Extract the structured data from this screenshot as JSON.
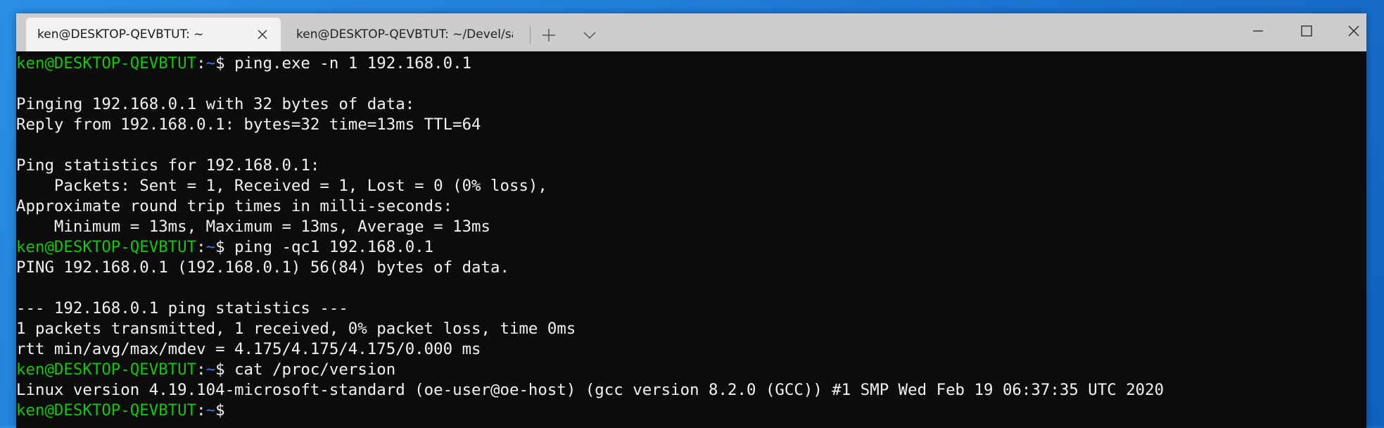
{
  "tabs": [
    {
      "label": "ken@DESKTOP-QEVBTUT: ~"
    },
    {
      "label": "ken@DESKTOP-QEVBTUT: ~/Devel/sa"
    }
  ],
  "prompt": {
    "user_host": "ken@DESKTOP-QEVBTUT",
    "sep": ":",
    "path": "~",
    "symbol": "$"
  },
  "lines": [
    {
      "type": "prompt",
      "cmd": " ping.exe -n 1 192.168.0.1"
    },
    {
      "type": "out",
      "text": ""
    },
    {
      "type": "out",
      "text": "Pinging 192.168.0.1 with 32 bytes of data:"
    },
    {
      "type": "out",
      "text": "Reply from 192.168.0.1: bytes=32 time=13ms TTL=64"
    },
    {
      "type": "out",
      "text": ""
    },
    {
      "type": "out",
      "text": "Ping statistics for 192.168.0.1:"
    },
    {
      "type": "out",
      "text": "    Packets: Sent = 1, Received = 1, Lost = 0 (0% loss),"
    },
    {
      "type": "out",
      "text": "Approximate round trip times in milli-seconds:"
    },
    {
      "type": "out",
      "text": "    Minimum = 13ms, Maximum = 13ms, Average = 13ms"
    },
    {
      "type": "prompt",
      "cmd": " ping -qc1 192.168.0.1"
    },
    {
      "type": "out",
      "text": "PING 192.168.0.1 (192.168.0.1) 56(84) bytes of data."
    },
    {
      "type": "out",
      "text": ""
    },
    {
      "type": "out",
      "text": "--- 192.168.0.1 ping statistics ---"
    },
    {
      "type": "out",
      "text": "1 packets transmitted, 1 received, 0% packet loss, time 0ms"
    },
    {
      "type": "out",
      "text": "rtt min/avg/max/mdev = 4.175/4.175/4.175/0.000 ms"
    },
    {
      "type": "prompt",
      "cmd": " cat /proc/version"
    },
    {
      "type": "out",
      "text": "Linux version 4.19.104-microsoft-standard (oe-user@oe-host) (gcc version 8.2.0 (GCC)) #1 SMP Wed Feb 19 06:37:35 UTC 2020"
    },
    {
      "type": "prompt",
      "cmd": ""
    }
  ]
}
